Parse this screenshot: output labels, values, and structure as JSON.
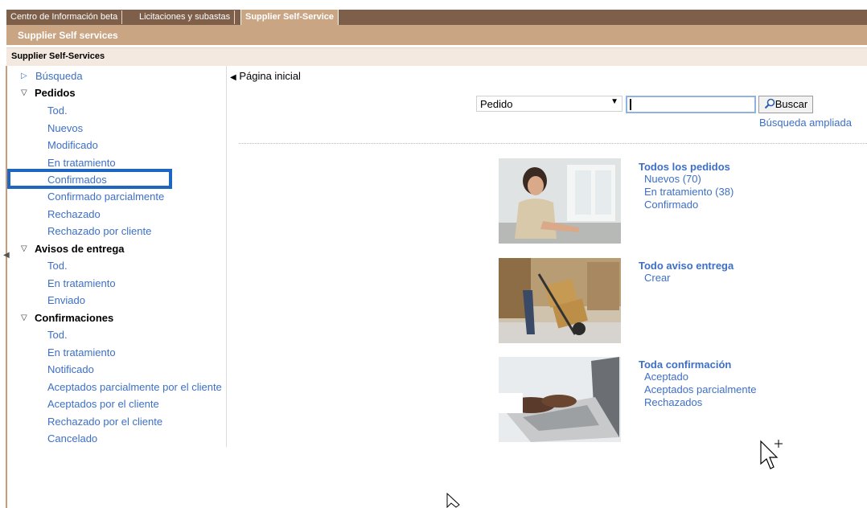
{
  "top_tabs": [
    {
      "label": "Centro de Información beta"
    },
    {
      "label": "Licitaciones y subastas"
    },
    {
      "label": "Supplier Self-Service"
    }
  ],
  "sub_header": "Supplier Self services",
  "page_header": "Supplier Self-Services",
  "sidebar": {
    "search": "Búsqueda",
    "pedidos": {
      "title": "Pedidos",
      "items": [
        "Tod.",
        "Nuevos",
        "Modificado",
        "En tratamiento",
        "Confirmados",
        "Confirmado parcialmente",
        "Rechazado",
        "Rechazado por cliente"
      ]
    },
    "avisos": {
      "title": "Avisos de entrega",
      "items": [
        "Tod.",
        "En tratamiento",
        "Enviado"
      ]
    },
    "confirmaciones": {
      "title": "Confirmaciones",
      "items": [
        "Tod.",
        "En tratamiento",
        "Notificado",
        "Aceptados parcialmente por el cliente",
        "Aceptados por el cliente",
        "Rechazado por el cliente",
        "Cancelado"
      ]
    }
  },
  "main": {
    "back_label": "Página inicial",
    "search_select": "Pedido",
    "search_input_value": "",
    "search_button": "Buscar",
    "advanced_search": "Búsqueda ampliada",
    "groups": [
      {
        "title": "Todos los pedidos",
        "links": [
          "Nuevos (70)",
          "En tratamiento (38)",
          "Confirmado"
        ]
      },
      {
        "title": "Todo aviso entrega",
        "links": [
          "Crear"
        ]
      },
      {
        "title": "Toda confirmación",
        "links": [
          "Aceptado",
          "Aceptados parcialmente",
          "Rechazados"
        ]
      }
    ]
  },
  "colors": {
    "top_bar": "#7d5f4a",
    "accent_bar": "#c9a584",
    "link": "#3d6fc7",
    "highlight": "#1f66c0"
  }
}
